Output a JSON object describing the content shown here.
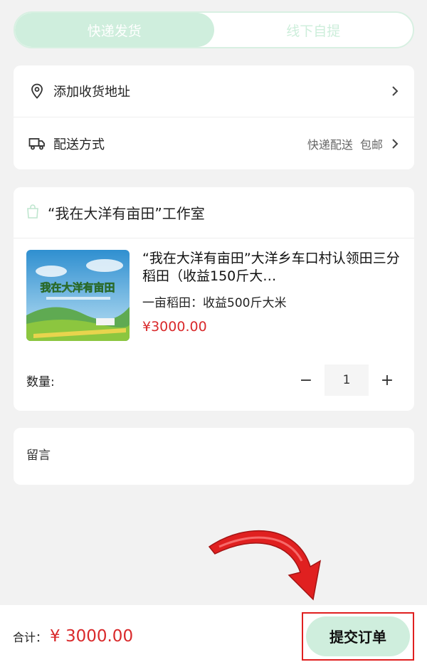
{
  "tabs": [
    {
      "label": "快递发货",
      "active": true
    },
    {
      "label": "线下自提",
      "active": false
    }
  ],
  "address": {
    "label": "添加收货地址",
    "icon": "location-pin-icon"
  },
  "delivery": {
    "label": "配送方式",
    "value": "快递配送  包邮",
    "icon": "truck-icon"
  },
  "shop": {
    "name": "“我在大洋有亩田”工作室",
    "icon": "shopping-bag-icon"
  },
  "product": {
    "title": "“我在大洋有亩田”大洋乡车口村认领田三分稻田（收益150斤大…",
    "spec": "一亩稻田：收益500斤大米",
    "price": "¥3000.00",
    "image_text": "我在大洋有亩田"
  },
  "quantity": {
    "label": "数量:",
    "value": "1",
    "minus": "−",
    "plus": "+"
  },
  "memo": {
    "label": "留言"
  },
  "footer": {
    "total_label": "合计：",
    "total_value": "¥ 3000.00",
    "submit_label": "提交订单"
  },
  "colors": {
    "accent": "#cfeedd",
    "price": "#d9292b",
    "highlight": "#e02020"
  }
}
